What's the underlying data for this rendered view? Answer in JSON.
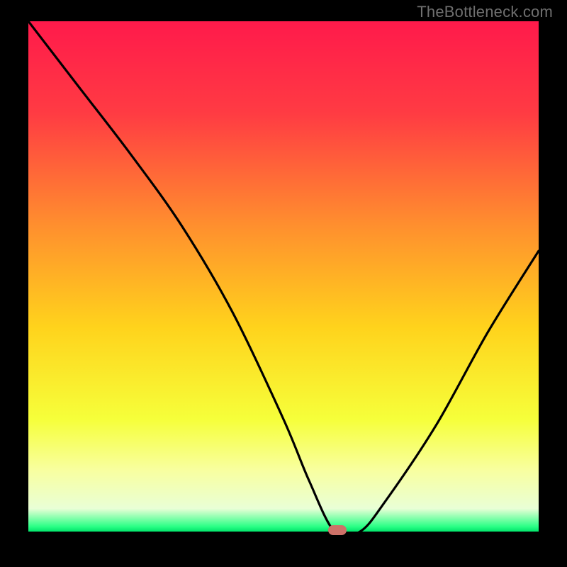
{
  "watermark": "TheBottleneck.com",
  "marker": {
    "x_pct": 60.5,
    "y_pct": 99.7
  },
  "chart_data": {
    "type": "line",
    "title": "",
    "xlabel": "",
    "ylabel": "",
    "xlim": [
      0,
      100
    ],
    "ylim": [
      0,
      100
    ],
    "series": [
      {
        "name": "bottleneck-curve",
        "x": [
          0,
          10,
          20,
          30,
          40,
          50,
          55,
          60,
          65,
          70,
          80,
          90,
          100
        ],
        "y": [
          100,
          87,
          74,
          60,
          43,
          22,
          10,
          0,
          0,
          6,
          21,
          39,
          55
        ]
      }
    ],
    "gradient_stops": [
      {
        "offset": 0.0,
        "color": "#ff1a4b"
      },
      {
        "offset": 0.18,
        "color": "#ff3b43"
      },
      {
        "offset": 0.4,
        "color": "#ff8f2e"
      },
      {
        "offset": 0.6,
        "color": "#ffd31c"
      },
      {
        "offset": 0.78,
        "color": "#f6ff3a"
      },
      {
        "offset": 0.88,
        "color": "#f8ffa0"
      },
      {
        "offset": 0.955,
        "color": "#e9ffd6"
      },
      {
        "offset": 0.99,
        "color": "#2bff86"
      },
      {
        "offset": 1.0,
        "color": "#01e46a"
      }
    ]
  }
}
